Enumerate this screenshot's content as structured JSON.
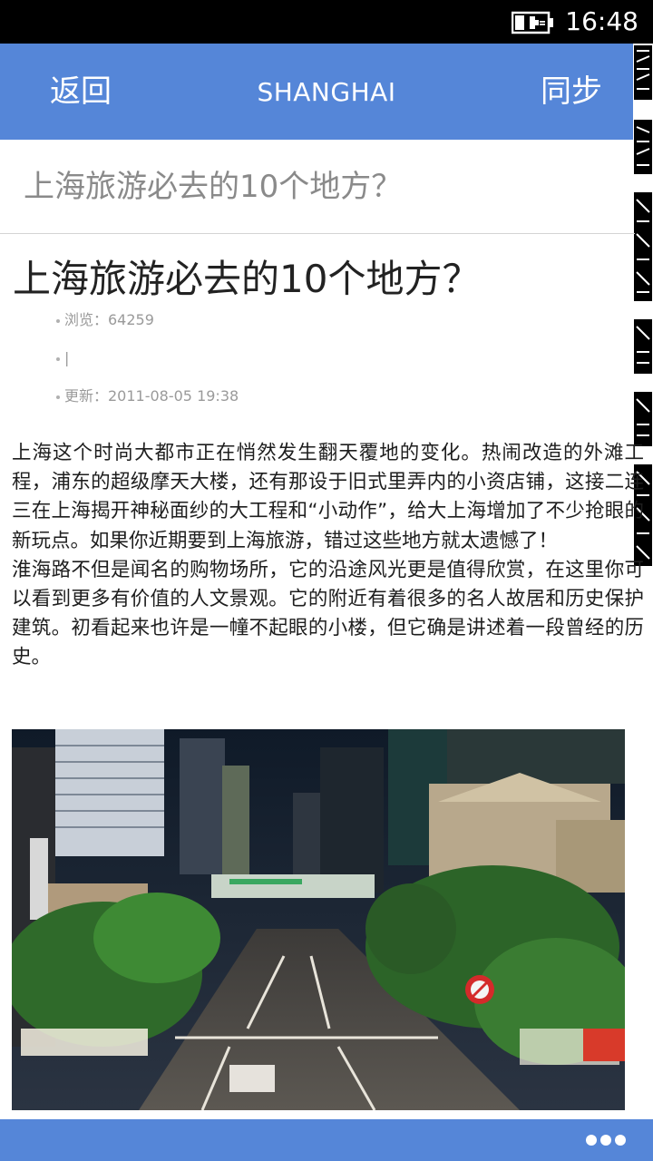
{
  "status_bar": {
    "time": "16:48",
    "battery_icon": "battery-charging-icon"
  },
  "header": {
    "back_label": "返回",
    "title": "SHANGHAI",
    "sync_label": "同步",
    "bg_color": "#5586d8"
  },
  "subtitle": "上海旅游必去的10个地方？",
  "article": {
    "title": "上海旅游必去的10个地方？",
    "meta_views": "浏览：64259",
    "meta_blank": "|",
    "meta_updated": "更新：2011-08-05 19:38",
    "paragraphs": [
      "上海这个时尚大都市正在悄然发生翻天覆地的变化。热闹改造的外滩工程，浦东的超级摩天大楼，还有那设于旧式里弄内的小资店铺，这接二连三在上海揭开神秘面纱的大工程和“小动作”，给大上海增加了不少抢眼的新玩点。如果你近期要到上海旅游，错过这些地方就太遗憾了！",
      "淮海路不但是闻名的购物场所，它的沿途风光更是值得欣赏，在这里你可以看到更多有价值的人文景观。它的附近有着很多的名人故居和历史保护建筑。初看起来也许是一幢不起眼的小楼，但它确是讲述着一段曾经的历史。"
    ],
    "photo_icon": "night-street-photo"
  },
  "bottom_bar": {
    "more_icon": "more-options-icon"
  }
}
